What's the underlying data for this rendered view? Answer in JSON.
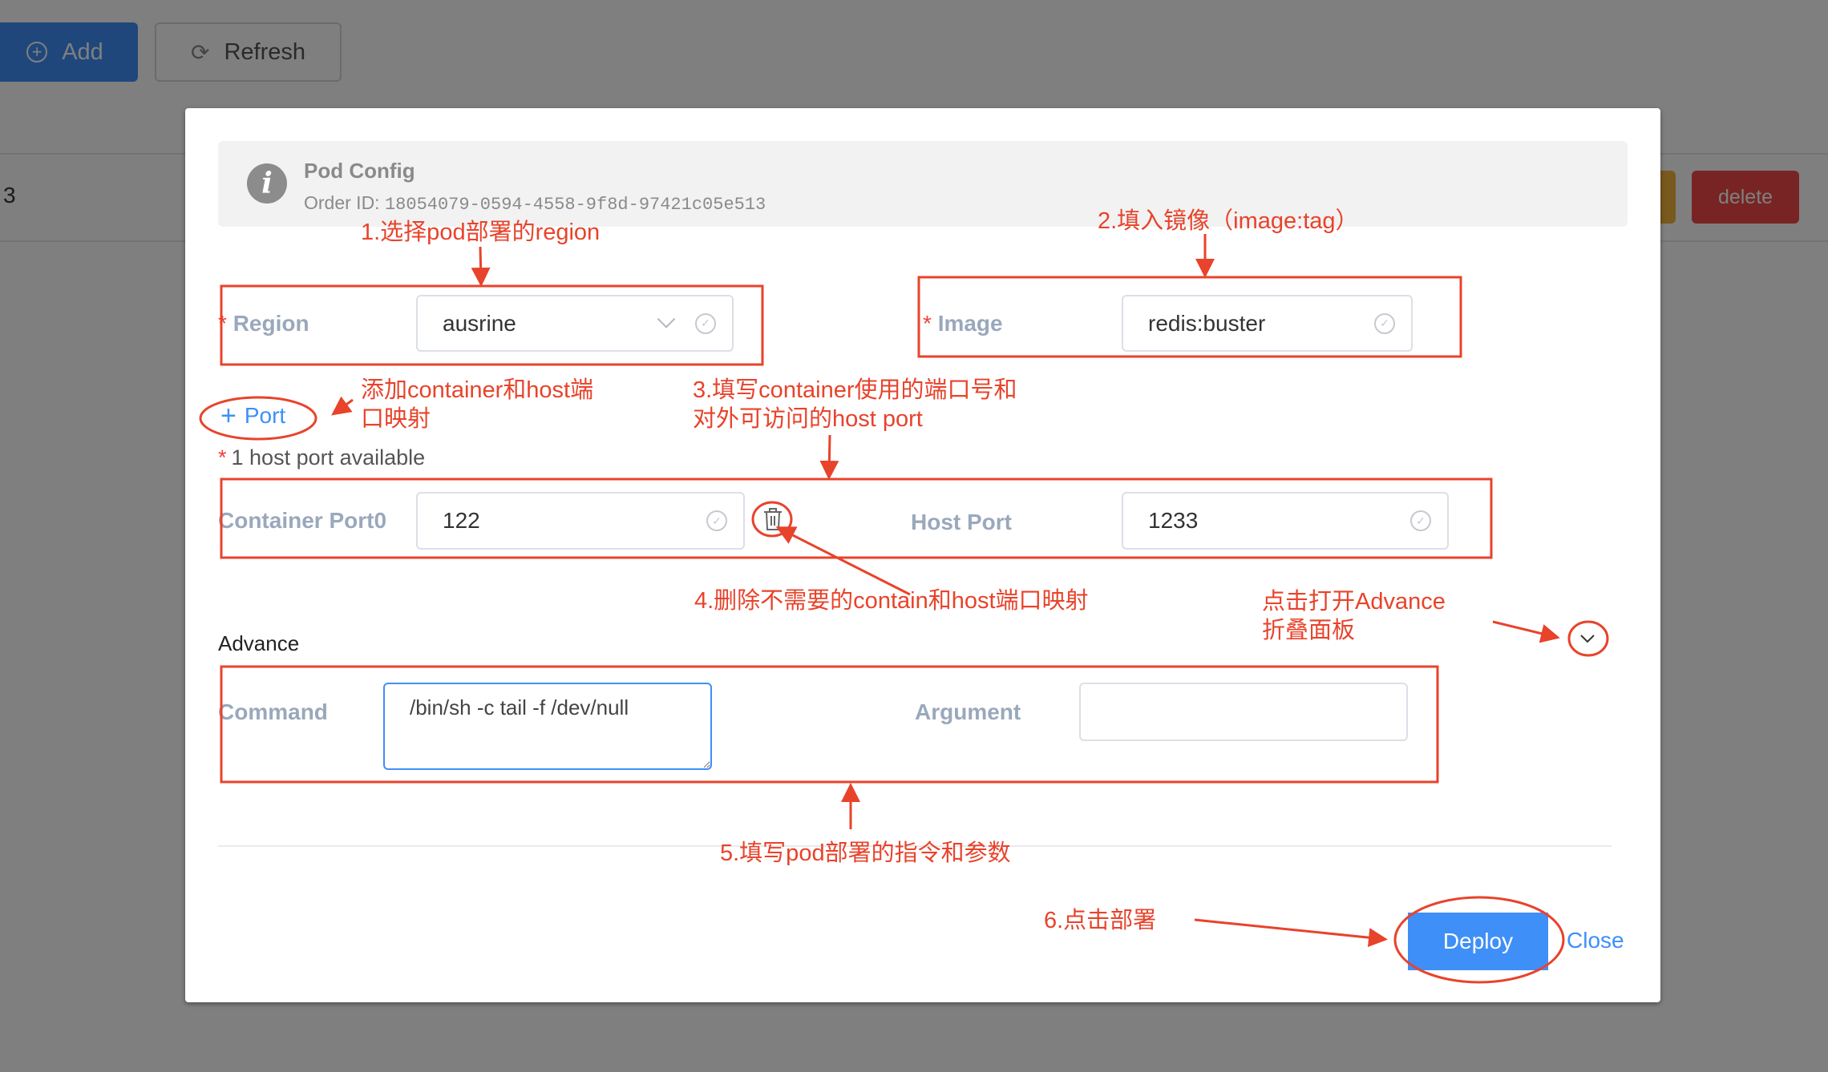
{
  "background": {
    "toolbar": {
      "add_label": "Add",
      "refresh_label": "Refresh"
    },
    "table_row": {
      "index": "3",
      "delete_label": "delete"
    }
  },
  "modal": {
    "alert": {
      "title": "Pod Config",
      "order_id_label": "Order ID:",
      "order_id": "18054079-0594-4558-9f8d-97421c05e513"
    },
    "region": {
      "label": "Region",
      "required": "*",
      "value": "ausrine"
    },
    "image": {
      "label": "Image",
      "required": "*",
      "value": "redis:buster"
    },
    "add_port": {
      "icon": "plus-icon",
      "label": "Port"
    },
    "host_port_hint": {
      "required": "*",
      "text": "1 host port available"
    },
    "ports": [
      {
        "container_label": "Container Port0",
        "container_value": "122",
        "host_label": "Host Port",
        "host_value": "1233"
      }
    ],
    "advance": {
      "title": "Advance",
      "command_label": "Command",
      "command_value": "/bin/sh -c tail -f /dev/null",
      "argument_label": "Argument",
      "argument_value": ""
    },
    "footer": {
      "deploy_label": "Deploy",
      "close_label": "Close"
    }
  },
  "annotations": {
    "step1": "1.选择pod部署的region",
    "step2": "2.填入镜像（image:tag）",
    "add_port_line1": "添加container和host端",
    "add_port_line2": "口映射",
    "step3_line1": "3.填写container使用的端口号和",
    "step3_line2": "对外可访问的host port",
    "step4": "4.删除不需要的contain和host端口映射",
    "advance_line1": "点击打开Advance",
    "advance_line2": "折叠面板",
    "step5": "5.填写pod部署的指令和参数",
    "step6": "6.点击部署"
  },
  "colors": {
    "primary": "#3f8ff8",
    "danger": "#f04848",
    "warning": "#f3b33b",
    "annotation": "#e8432b",
    "label": "#9aa8bc"
  }
}
